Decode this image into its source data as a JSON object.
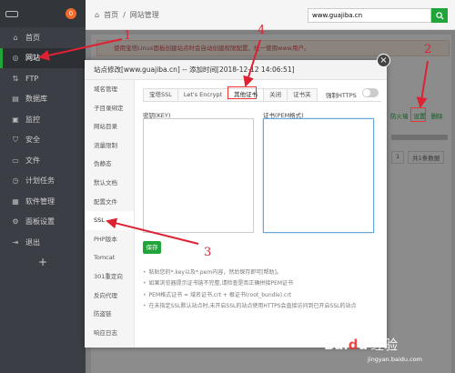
{
  "sidebar": {
    "badge": "0",
    "items": [
      {
        "label": "首页",
        "icon": "home-icon",
        "glyph": "⌂"
      },
      {
        "label": "网站",
        "icon": "globe-icon",
        "glyph": "◎",
        "active": true
      },
      {
        "label": "FTP",
        "icon": "ftp-icon",
        "glyph": "⇅"
      },
      {
        "label": "数据库",
        "icon": "database-icon",
        "glyph": "▤"
      },
      {
        "label": "监控",
        "icon": "monitor-icon",
        "glyph": "▣"
      },
      {
        "label": "安全",
        "icon": "shield-icon",
        "glyph": "⛉"
      },
      {
        "label": "文件",
        "icon": "folder-icon",
        "glyph": "▭"
      },
      {
        "label": "计划任务",
        "icon": "clock-icon",
        "glyph": "◷"
      },
      {
        "label": "软件管理",
        "icon": "apps-icon",
        "glyph": "▦"
      },
      {
        "label": "面板设置",
        "icon": "gear-icon",
        "glyph": "⚙"
      },
      {
        "label": "退出",
        "icon": "logout-icon",
        "glyph": "⇥"
      }
    ],
    "add": "+"
  },
  "topbar": {
    "home": "首页",
    "separator": "/",
    "current": "网站管理",
    "search_value": "www.guajiba.cn"
  },
  "background": {
    "warning": "使用宝塔Linux面板创建站点时会自动创建权限配置，统一使用www用户。",
    "actions": [
      "防火墙",
      "设置",
      "删除"
    ],
    "pager": [
      "1",
      "共1条数据"
    ]
  },
  "modal": {
    "title": "站点修改[www.guajiba.cn] -- 添加时间[2018-12-12 14:06:51]",
    "close": "×",
    "side_items": [
      "域名管理",
      "子目录绑定",
      "网站目录",
      "流量限制",
      "伪静态",
      "默认文档",
      "配置文件",
      "SSL",
      "PHP版本",
      "Tomcat",
      "301重定向",
      "反向代理",
      "防盗链",
      "响应日志"
    ],
    "tabs": [
      "宝塔SSL",
      "Let's Encrypt",
      "其他证书",
      "关闭",
      "证书夹"
    ],
    "https_label": "强制HTTPS",
    "key_label": "密钥(KEY)",
    "pem_label": "证书(PEM格式)",
    "save": "保存",
    "tips": [
      "粘贴您的*.key以及*.pem内容，然后保存即可[帮助]。",
      "如果浏览器提示证书链不完整,请检查是否正确拼接PEM证书",
      "PEM格式证书 = 域名证书.crt + 根证书(root_bundle).crt",
      "在未指定SSL默认站点时,未开启SSL的站点使用HTTPS会直接访问到已开启SSL的站点"
    ]
  },
  "annotations": {
    "one": "1",
    "two": "2",
    "three": "3",
    "four": "4",
    "color": "#dd2233"
  },
  "watermark": {
    "logo_a": "Bai",
    "logo_paw": "d",
    "logo_b": "u",
    "text": "经验",
    "sub": "jingyan.baidu.com"
  }
}
